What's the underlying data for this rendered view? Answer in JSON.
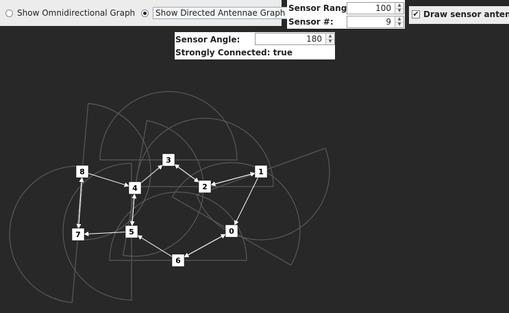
{
  "controls": {
    "radio_omni": {
      "label": "Show Omnidirectional Graph",
      "selected": false
    },
    "radio_directed": {
      "label": "Show Directed Antennae Graph",
      "selected": true
    },
    "sensor_range": {
      "label": "Sensor Range:",
      "value": "100"
    },
    "sensor_count": {
      "label": "Sensor #:",
      "value": "9"
    },
    "sensor_angle": {
      "label": "Sensor Angle:",
      "value": "180"
    },
    "strongly_connected": "Strongly Connected: true",
    "draw_antenna": {
      "label": "Draw sensor antenna",
      "checked": true
    }
  },
  "graph": {
    "background": "#282828",
    "wedge_color": "#5a5a5a",
    "edge_color": "#ffffff",
    "node_fill": "#ffffff",
    "nodes": [
      {
        "id": "0",
        "label": "0"
      },
      {
        "id": "1",
        "label": "1"
      },
      {
        "id": "2",
        "label": "2"
      },
      {
        "id": "3",
        "label": "3"
      },
      {
        "id": "4",
        "label": "4"
      },
      {
        "id": "5",
        "label": "5"
      },
      {
        "id": "6",
        "label": "6"
      },
      {
        "id": "7",
        "label": "7"
      },
      {
        "id": "8",
        "label": "8"
      }
    ],
    "edges": [
      {
        "from": "8",
        "to": "4"
      },
      {
        "from": "8",
        "to": "7"
      },
      {
        "from": "7",
        "to": "8"
      },
      {
        "from": "4",
        "to": "3"
      },
      {
        "from": "4",
        "to": "5"
      },
      {
        "from": "5",
        "to": "4"
      },
      {
        "from": "5",
        "to": "7"
      },
      {
        "from": "3",
        "to": "2"
      },
      {
        "from": "2",
        "to": "3"
      },
      {
        "from": "2",
        "to": "1"
      },
      {
        "from": "1",
        "to": "2"
      },
      {
        "from": "1",
        "to": "0"
      },
      {
        "from": "0",
        "to": "6"
      },
      {
        "from": "6",
        "to": "0"
      },
      {
        "from": "6",
        "to": "5"
      }
    ]
  }
}
